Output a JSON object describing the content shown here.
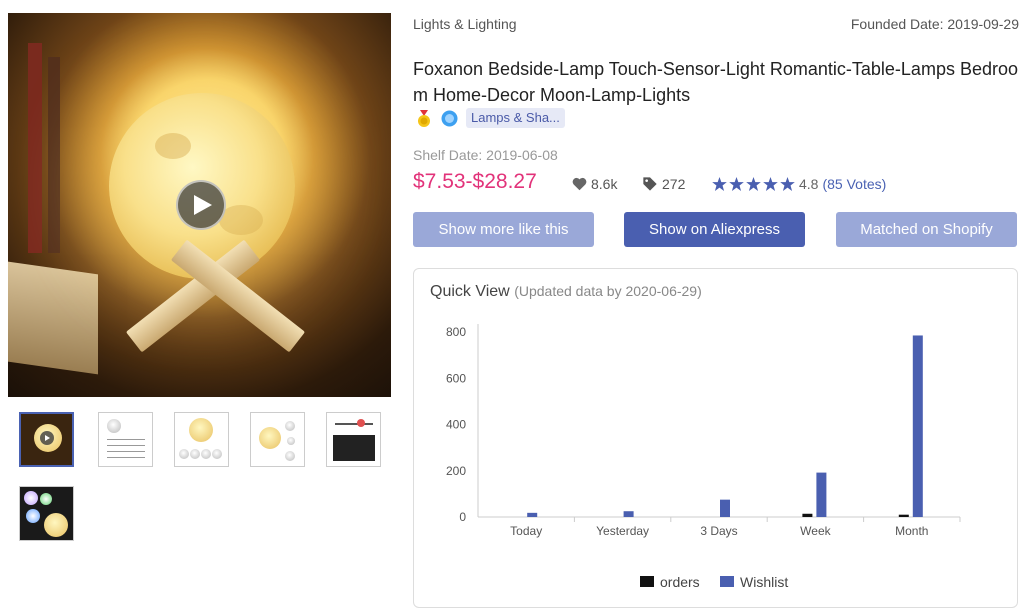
{
  "header": {
    "category": "Lights & Lighting",
    "founded": "Founded Date: 2019-09-29"
  },
  "product": {
    "title": "Foxanon Bedside-Lamp Touch-Sensor-Light Romantic-Table-Lamps Bedroom Home-Decor Moon-Lamp-Lights",
    "tag": "Lamps & Sha...",
    "shelf_date": "Shelf Date: 2019-06-08",
    "price": "$7.53-$28.27",
    "likes": "8.6k",
    "tags_count": "272",
    "rating": "4.8",
    "votes": "(85 Votes)",
    "stars": 5,
    "price_color": "#e2337a"
  },
  "buttons": {
    "more_like": "Show more like this",
    "aliexpress": "Show on Aliexpress",
    "shopify": "Matched on Shopify"
  },
  "quick_view": {
    "title": "Quick View",
    "subtitle": "(Updated data by 2020-06-29)"
  },
  "chart_data": {
    "type": "bar",
    "categories": [
      "Today",
      "Yesterday",
      "3 Days",
      "Week",
      "Month"
    ],
    "series": [
      {
        "name": "orders",
        "color": "#111111",
        "values": [
          0,
          0,
          0,
          14,
          10
        ]
      },
      {
        "name": "Wishlist",
        "color": "#4a5fb0",
        "values": [
          18,
          25,
          75,
          192,
          785
        ]
      }
    ],
    "ylim": [
      0,
      800
    ],
    "yticks": [
      0,
      200,
      400,
      600,
      800
    ],
    "legend": "bottom-center"
  }
}
